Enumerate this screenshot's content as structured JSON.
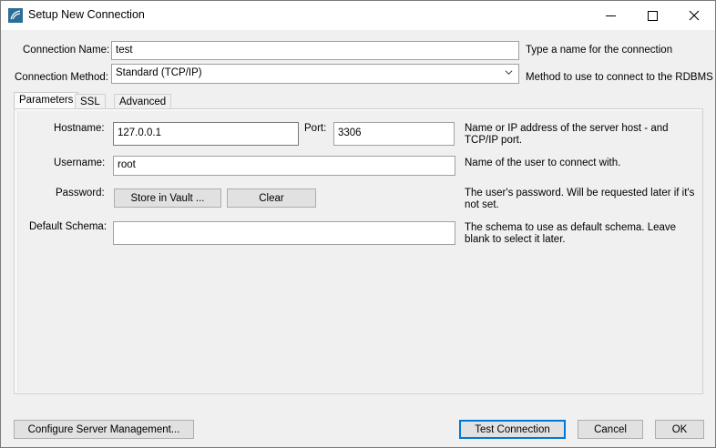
{
  "window": {
    "title": "Setup New Connection"
  },
  "form": {
    "connection_name_label": "Connection Name:",
    "connection_name_value": "test",
    "connection_name_help": "Type a name for the connection",
    "connection_method_label": "Connection Method:",
    "connection_method_value": "Standard (TCP/IP)",
    "connection_method_help": "Method to use to connect to the RDBMS"
  },
  "tabs": [
    {
      "label": "Parameters"
    },
    {
      "label": "SSL"
    },
    {
      "label": "Advanced"
    }
  ],
  "parameters": {
    "hostname_label": "Hostname:",
    "hostname_value": "127.0.0.1",
    "port_label": "Port:",
    "port_value": "3306",
    "hostname_help_1": "Name or IP address of the server host - and",
    "hostname_help_2": "TCP/IP port.",
    "username_label": "Username:",
    "username_value": "root",
    "username_help": "Name of the user to connect with.",
    "password_label": "Password:",
    "store_vault_button": "Store in Vault ...",
    "clear_button": "Clear",
    "password_help_1": "The user's password. Will be requested later if it's",
    "password_help_2": "not set.",
    "schema_label": "Default Schema:",
    "schema_value": "",
    "schema_help_1": "The schema to use as default schema. Leave",
    "schema_help_2": "blank to select it later."
  },
  "footer": {
    "configure_button": "Configure Server Management...",
    "test_button": "Test Connection",
    "cancel_button": "Cancel",
    "ok_button": "OK"
  }
}
